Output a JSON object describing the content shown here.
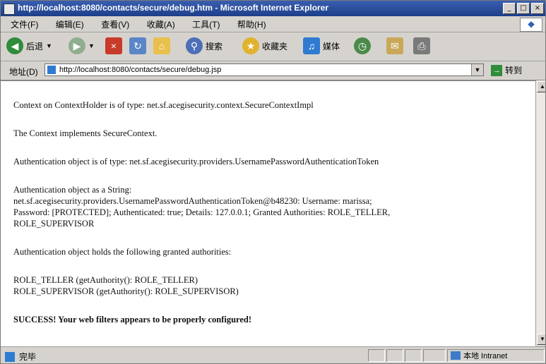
{
  "window": {
    "title": "http://localhost:8080/contacts/secure/debug.htm - Microsoft Internet Explorer",
    "controls": [
      "_",
      "□",
      "×"
    ]
  },
  "menu": {
    "items": [
      "文件(F)",
      "编辑(E)",
      "查看(V)",
      "收藏(A)",
      "工具(T)",
      "帮助(H)"
    ]
  },
  "toolbar": {
    "back_label": "后退",
    "search_label": "搜索",
    "favorites_label": "收藏夹",
    "media_label": "媒体"
  },
  "address": {
    "label": "地址(D)",
    "url": "http://localhost:8080/contacts/secure/debug.jsp",
    "go_label": "转到"
  },
  "content": {
    "lines": [
      "Context on ContextHolder is of type: net.sf.acegisecurity.context.SecureContextImpl",
      "The Context implements SecureContext.",
      "Authentication object is of type: net.sf.acegisecurity.providers.UsernamePasswordAuthenticationToken",
      "Authentication object as a String:",
      "net.sf.acegisecurity.providers.UsernamePasswordAuthenticationToken@b48230: Username: marissa;",
      "Password: [PROTECTED]; Authenticated: true; Details: 127.0.0.1; Granted Authorities: ROLE_TELLER,",
      "ROLE_SUPERVISOR",
      "Authentication object holds the following granted authorities:",
      "ROLE_TELLER (getAuthority(): ROLE_TELLER)",
      "ROLE_SUPERVISOR (getAuthority(): ROLE_SUPERVISOR)",
      "SUCCESS! Your web filters appears to be properly configured!"
    ]
  },
  "status": {
    "left_text": "完毕",
    "zone_text": "本地 Intranet"
  },
  "colors": {
    "titlebar": "#1d3f8a",
    "chrome": "#d6d3ce"
  }
}
